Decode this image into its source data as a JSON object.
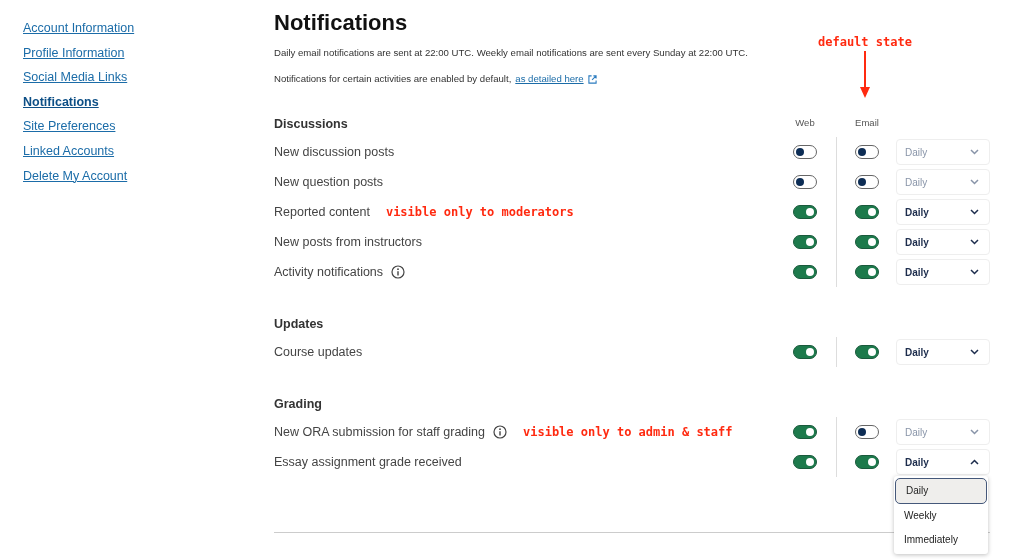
{
  "sidebar": {
    "items": [
      {
        "label": "Account Information",
        "selected": false
      },
      {
        "label": "Profile Information",
        "selected": false
      },
      {
        "label": "Social Media Links",
        "selected": false
      },
      {
        "label": "Notifications",
        "selected": true
      },
      {
        "label": "Site Preferences",
        "selected": false
      },
      {
        "label": "Linked Accounts",
        "selected": false
      },
      {
        "label": "Delete My Account",
        "selected": false
      }
    ]
  },
  "title": "Notifications",
  "schedule_note": "Daily email notifications are sent at 22:00 UTC. Weekly email notifications are sent every Sunday at 22:00 UTC.",
  "defaults_note": {
    "text": "Notifications for certain activities are enabled by default,",
    "link": "as detailed here"
  },
  "annotation": "default state",
  "columns": {
    "web": "Web",
    "email": "Email"
  },
  "sections": [
    {
      "title": "Discussions",
      "rows": [
        {
          "label": "New discussion posts",
          "info": false,
          "web": false,
          "email": false,
          "frequency": "Daily",
          "open": false
        },
        {
          "label": "New question posts",
          "info": false,
          "web": false,
          "email": false,
          "frequency": "Daily",
          "open": false
        },
        {
          "label": "Reported content",
          "info": false,
          "note": "visible only to moderators",
          "web": true,
          "email": true,
          "frequency": "Daily",
          "open": false
        },
        {
          "label": "New posts from instructors",
          "info": false,
          "web": true,
          "email": true,
          "frequency": "Daily",
          "open": false
        },
        {
          "label": "Activity notifications",
          "info": true,
          "web": true,
          "email": true,
          "frequency": "Daily",
          "open": false
        }
      ]
    },
    {
      "title": "Updates",
      "rows": [
        {
          "label": "Course updates",
          "info": false,
          "web": true,
          "email": true,
          "frequency": "Daily",
          "open": false
        }
      ]
    },
    {
      "title": "Grading",
      "rows": [
        {
          "label": "New ORA submission for staff grading",
          "info": true,
          "note": "visible only to admin & staff",
          "web": true,
          "email": false,
          "frequency": "Daily",
          "open": false
        },
        {
          "label": "Essay assignment grade received",
          "info": false,
          "web": true,
          "email": true,
          "frequency": "Daily",
          "open": true
        }
      ]
    }
  ],
  "frequency_menu": [
    {
      "label": "Daily",
      "selected": true
    },
    {
      "label": "Weekly",
      "selected": false
    },
    {
      "label": "Immediately",
      "selected": false
    }
  ]
}
